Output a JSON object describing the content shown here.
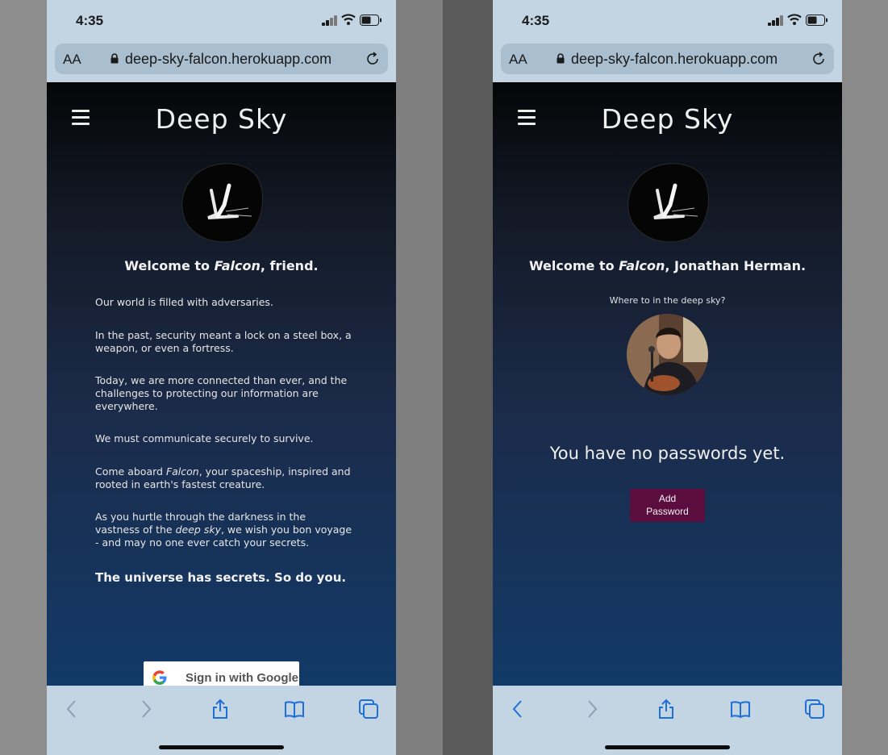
{
  "left_phone": {
    "status": {
      "time": "4:35"
    },
    "browser": {
      "text_size": "AA",
      "url": "deep-sky-falcon.herokuapp.com"
    },
    "app": {
      "brand": "Deep Sky",
      "welcome": {
        "prefix": "Welcome to ",
        "name": "Falcon",
        "suffix": ", friend."
      },
      "paragraphs": {
        "p1": "Our world is filled with adversaries.",
        "p2": "In the past, security meant a lock on a steel box, a weapon, or even a fortress.",
        "p3": "Today, we are more connected than ever, and the challenges to protecting our information are everywhere.",
        "p4": "We must communicate securely to survive.",
        "p5_a": "Come aboard ",
        "p5_b": "Falcon",
        "p5_c": ", your spaceship, inspired and rooted in earth's fastest creature.",
        "p6_a": "As you hurtle through the darkness in the vastness of the ",
        "p6_b": "deep sky",
        "p6_c": ", we wish you bon voyage - and may no one ever catch your secrets."
      },
      "tagline": "The universe has secrets. So do you.",
      "google_button": "Sign in with Google"
    }
  },
  "right_phone": {
    "status": {
      "time": "4:35"
    },
    "browser": {
      "text_size": "AA",
      "url": "deep-sky-falcon.herokuapp.com"
    },
    "app": {
      "brand": "Deep Sky",
      "welcome": {
        "prefix": "Welcome to ",
        "name": "Falcon",
        "suffix": ", Jonathan Herman."
      },
      "prompt": "Where to in the deep sky?",
      "empty_message": "You have no passwords yet.",
      "add_button": {
        "line1": "Add",
        "line2": "Password"
      }
    }
  },
  "colors": {
    "safari_chrome": "#c3d5e3",
    "url_field": "#a9bfd0",
    "accent_blue": "#1f6fd6",
    "add_button": "#5a0d3e"
  }
}
